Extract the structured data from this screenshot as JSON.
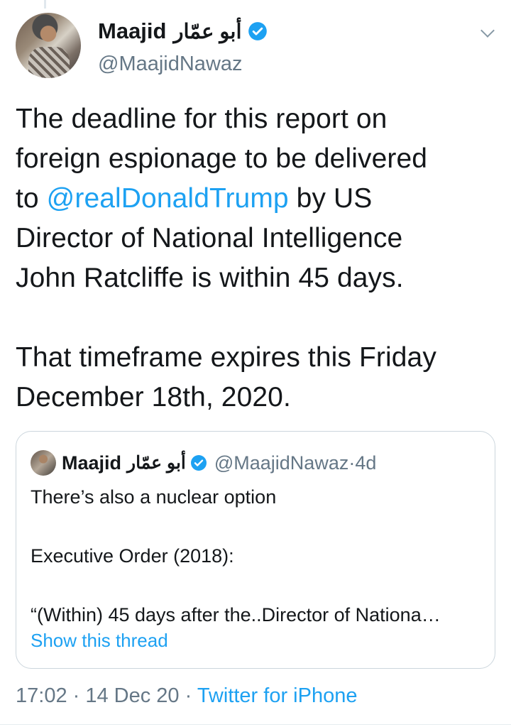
{
  "tweet": {
    "author": {
      "name": "Maajid",
      "name_arabic": "أبو عمّار",
      "handle": "@MaajidNawaz",
      "verified": true
    },
    "text": {
      "line1": "The deadline for this report on",
      "line2": "foreign espionage to be delivered",
      "line3_before": "to ",
      "line3_mention": "@realDonaldTrump",
      "line3_after": " by US",
      "line4": "Director of National Intelligence",
      "line5": "John Ratcliffe is within 45 days.",
      "line6": "That timeframe expires this Friday",
      "line7": "December 18th, 2020."
    },
    "timestamp": "17:02",
    "date": "14 Dec 20",
    "source": "Twitter for iPhone",
    "separator": " · "
  },
  "quoted": {
    "name": "Maajid",
    "name_arabic": "أبو عمّار",
    "handle": "@MaajidNawaz",
    "age": "4d",
    "separator": " · ",
    "line1": "There’s also a nuclear option",
    "line2": "Executive Order (2018):",
    "line3": "“(Within) 45 days after the..Director of Nationa…",
    "show_thread": "Show this thread"
  },
  "colors": {
    "link": "#1da1f2",
    "secondary": "#657786",
    "text": "#14171a",
    "border": "#ccd6dd"
  },
  "icons": [
    "verified-badge-icon",
    "chevron-down-icon",
    "author-avatar",
    "quoted-author-avatar"
  ]
}
